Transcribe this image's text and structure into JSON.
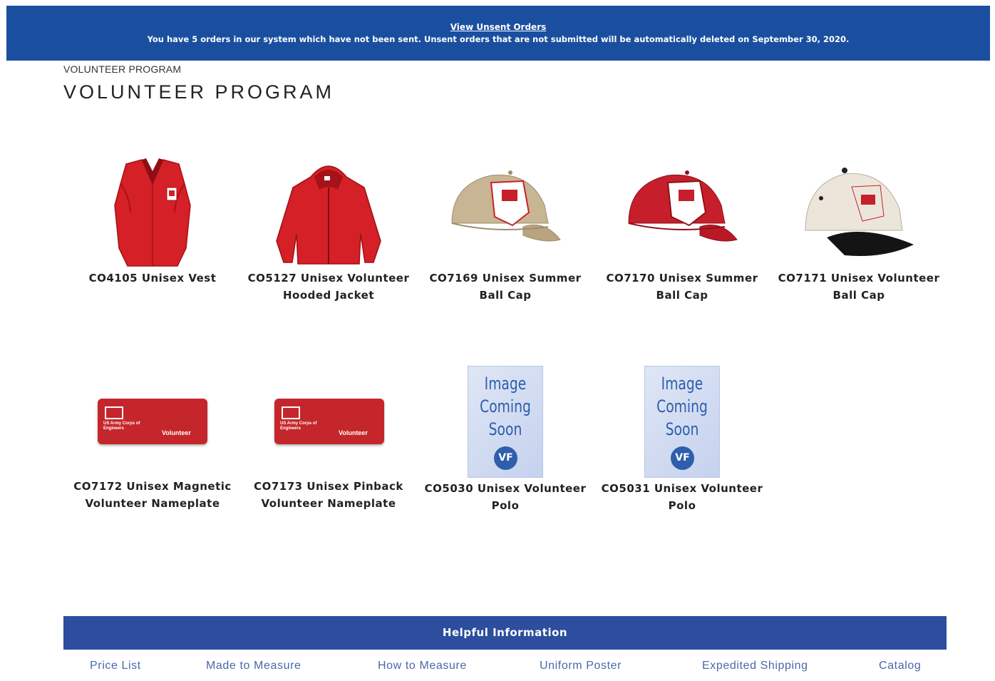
{
  "banner": {
    "link": "View Unsent Orders",
    "message": "You have 5 orders in our system which have not been sent. Unsent orders that are not submitted will be automatically deleted on September 30, 2020."
  },
  "breadcrumb": "VOLUNTEER PROGRAM",
  "title": "VOLUNTEER PROGRAM",
  "products": [
    {
      "name": "CO4105 Unisex Vest"
    },
    {
      "name": "CO5127 Unisex Volunteer Hooded Jacket"
    },
    {
      "name": "CO7169 Unisex Summer Ball Cap"
    },
    {
      "name": "CO7170 Unisex Summer Ball Cap"
    },
    {
      "name": "CO7171 Unisex Volunteer Ball Cap"
    },
    {
      "name": "CO7172 Unisex Magnetic Volunteer Nameplate"
    },
    {
      "name": "CO7173 Unisex Pinback Volunteer Nameplate"
    },
    {
      "name": "CO5030 Unisex Volunteer Polo",
      "placeholder": "Image Coming Soon",
      "badge": "VF"
    },
    {
      "name": "CO5031 Unisex Volunteer Polo",
      "placeholder": "Image Coming Soon",
      "badge": "VF"
    }
  ],
  "nameplate": {
    "org": "US Army Corps of Engineers",
    "label": "Volunteer"
  },
  "helpful": {
    "title": "Helpful Information",
    "links": [
      "Price List",
      "Made to Measure",
      "How to Measure",
      "Uniform Poster",
      "Expedited Shipping",
      "Catalog"
    ]
  },
  "colors": {
    "banner": "#1a4fa0",
    "info_bar": "#2d4e9e",
    "link": "#4a68a8",
    "product_red": "#d42026"
  }
}
